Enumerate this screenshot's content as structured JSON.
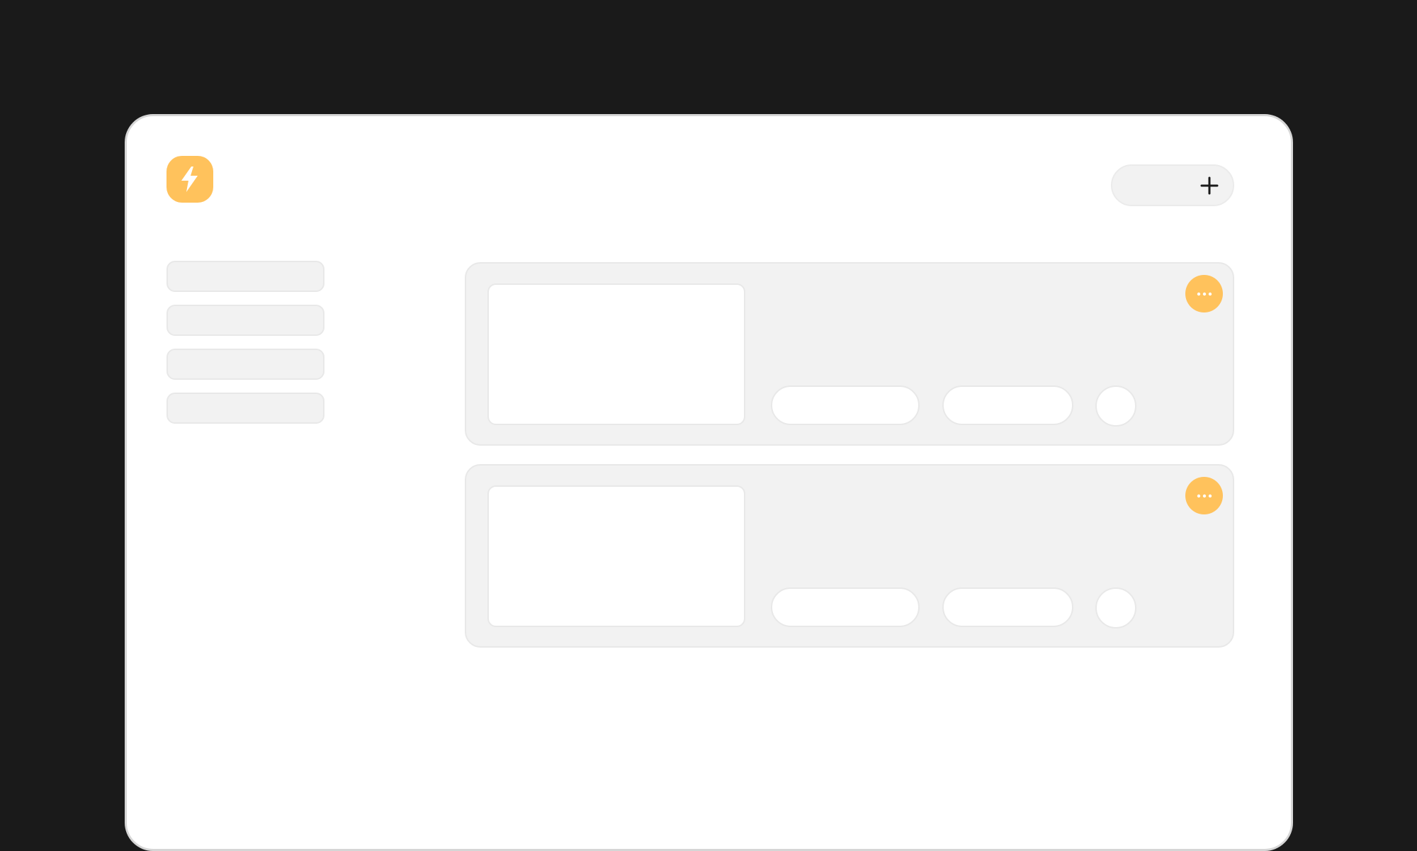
{
  "theme": {
    "accent": "#ffc25c",
    "background": "#1a1a1a",
    "surface": "#ffffff",
    "muted": "#f2f2f2"
  },
  "header": {
    "logo_icon": "lightning-bolt-icon",
    "add_icon": "plus-icon"
  },
  "sidebar": {
    "items": [
      {
        "label": ""
      },
      {
        "label": ""
      },
      {
        "label": ""
      },
      {
        "label": ""
      }
    ]
  },
  "cards": [
    {
      "more_icon": "more-horizontal-icon"
    },
    {
      "more_icon": "more-horizontal-icon"
    }
  ]
}
